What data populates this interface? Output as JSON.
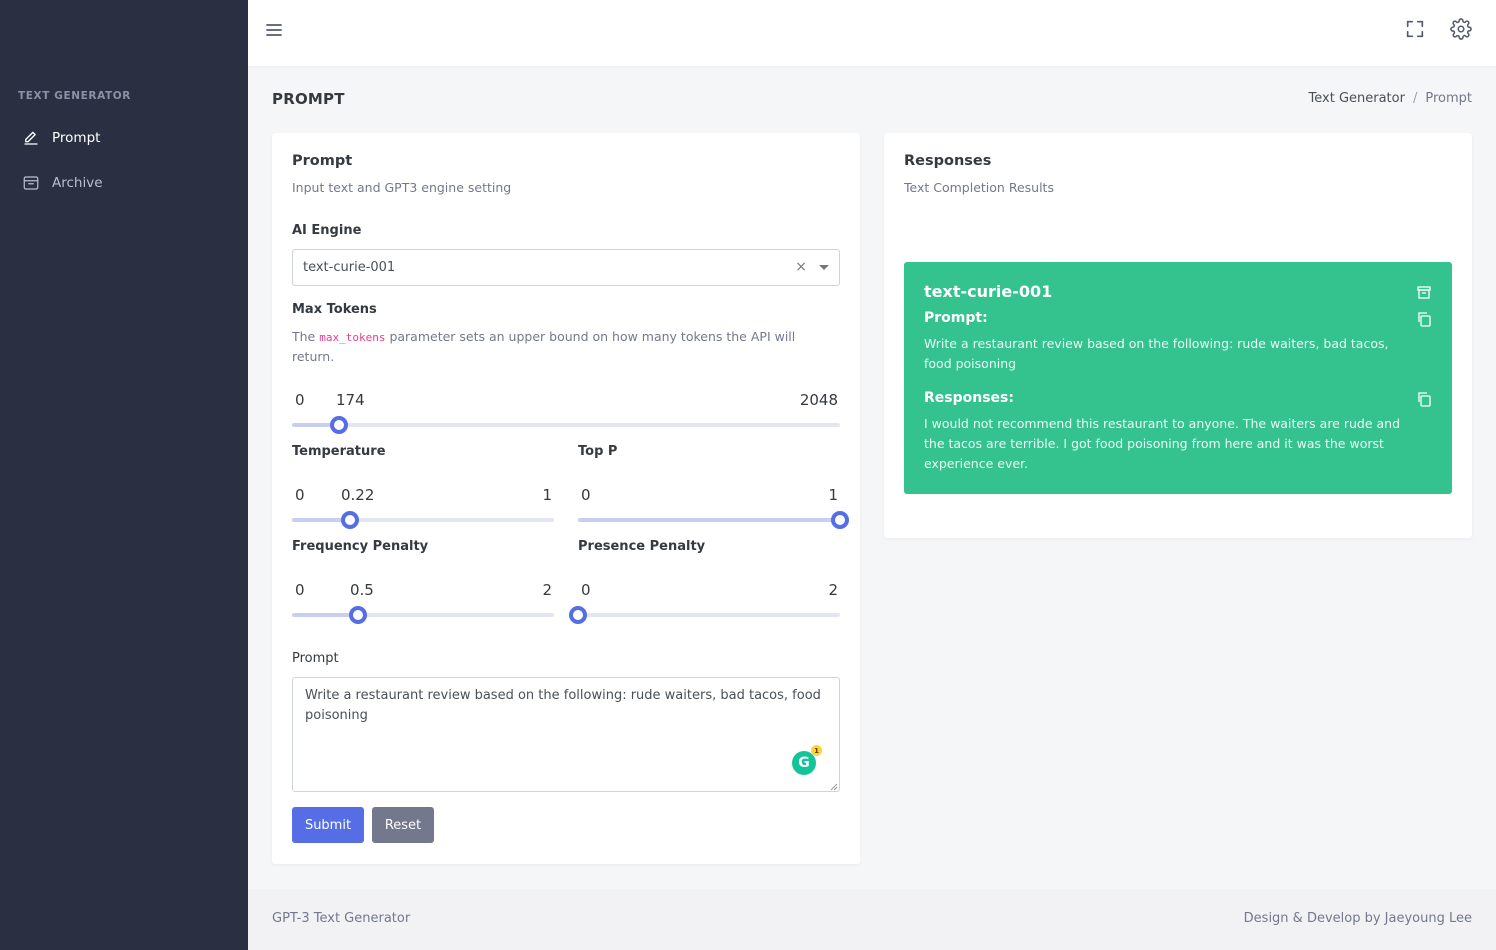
{
  "sidebar": {
    "section_title": "TEXT GENERATOR",
    "items": [
      {
        "label": "Prompt",
        "icon": "pencil-icon",
        "active": true
      },
      {
        "label": "Archive",
        "icon": "archive-icon",
        "active": false
      }
    ]
  },
  "topbar": {
    "icons": [
      "menu-icon",
      "fullscreen-icon",
      "gear-icon"
    ]
  },
  "page": {
    "title": "PROMPT",
    "breadcrumb": [
      "Text Generator",
      "Prompt"
    ],
    "breadcrumb_sep": "/"
  },
  "prompt_card": {
    "title": "Prompt",
    "subtitle": "Input text and GPT3 engine setting",
    "engine_label": "AI Engine",
    "engine_value": "text-curie-001",
    "clear_glyph": "×",
    "max_tokens_label": "Max Tokens",
    "max_tokens_desc_before": "The ",
    "max_tokens_desc_code": "max_tokens",
    "max_tokens_desc_after": " parameter sets an upper bound on how many tokens the API will return.",
    "sliders": {
      "max_tokens": {
        "min": "0",
        "value": "174",
        "max": "2048",
        "fraction": 0.085
      },
      "temperature": {
        "label": "Temperature",
        "min": "0",
        "value": "0.22",
        "max": "1",
        "fraction": 0.22
      },
      "top_p": {
        "label": "Top P",
        "min": "0",
        "value": "",
        "max": "1",
        "fraction": 1.0
      },
      "frequency_penalty": {
        "label": "Frequency Penalty",
        "min": "0",
        "value": "0.5",
        "max": "2",
        "fraction": 0.25
      },
      "presence_penalty": {
        "label": "Presence Penalty",
        "min": "0",
        "value": "",
        "max": "2",
        "fraction": 0.0
      }
    },
    "prompt_label": "Prompt",
    "prompt_value": "Write a restaurant review based on the following: rude waiters, bad tacos, food poisoning",
    "grammarly_count": "1",
    "submit_label": "Submit",
    "reset_label": "Reset"
  },
  "responses_card": {
    "title": "Responses",
    "subtitle": "Text Completion Results",
    "result": {
      "engine": "text-curie-001",
      "prompt_heading": "Prompt:",
      "prompt_text": "Write a restaurant review based on the following: rude waiters, bad tacos, food poisoning",
      "responses_heading": "Responses:",
      "response_text": "I would not recommend this restaurant to anyone. The waiters are rude and the tacos are terrible. I got food poisoning from here and it was the worst experience ever.",
      "color": "#34c38f"
    }
  },
  "footer": {
    "left": "GPT-3 Text Generator",
    "right": "Design & Develop by Jaeyoung Lee"
  },
  "colors": {
    "sidebar_bg": "#2a3042",
    "primary": "#556ee6",
    "success": "#34c38f",
    "secondary": "#74788d"
  }
}
